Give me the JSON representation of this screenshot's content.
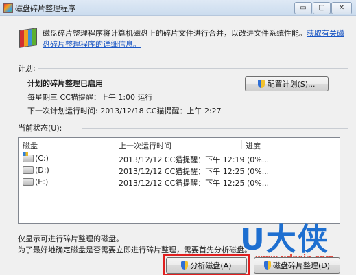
{
  "window": {
    "title": "磁盘碎片整理程序",
    "controls": {
      "minimize": "▭",
      "maximize": "▢",
      "close": "✕"
    }
  },
  "intro": {
    "text": "磁盘碎片整理程序将计算机磁盘上的碎片文件进行合并，以改进文件系统性能。",
    "link": "获取有关磁盘碎片整理程序的详细信息。"
  },
  "schedule": {
    "label": "计划:",
    "status": "计划的碎片整理已启用",
    "frequency": "每星期三  CC猫提醒：上午 1:00 运行",
    "next_run": "下一次计划运行时间: 2013/12/18 CC猫提醒：上午 2:27",
    "configure_button": "配置计划(S)..."
  },
  "current_status": {
    "label": "当前状态(U):",
    "columns": [
      "磁盘",
      "上一次运行时间",
      "进度"
    ],
    "rows": [
      {
        "disk": "(C:)",
        "last_run": "2013/12/12 CC猫提醒：下午 12:19 (0%...",
        "progress": ""
      },
      {
        "disk": "(D:)",
        "last_run": "2013/12/12 CC猫提醒：下午 12:25 (0%...",
        "progress": ""
      },
      {
        "disk": "(E:)",
        "last_run": "2013/12/12 CC猫提醒：下午 12:25 (0%...",
        "progress": ""
      }
    ]
  },
  "notes": {
    "line1": "仅显示可进行碎片整理的磁盘。",
    "line2": "为了最好地确定磁盘是否需要立即进行碎片整理，需要首先分析磁盘。"
  },
  "buttons": {
    "analyze": "分析磁盘(A)",
    "defragment": "磁盘碎片整理(D)"
  },
  "watermark": {
    "logo": "U大侠",
    "url": "www.udaxia.com"
  },
  "colors": {
    "link": "#1a56c4",
    "highlight_box": "#e02020",
    "watermark_blue": "#1e6fd0",
    "watermark_red": "#e0453a"
  }
}
